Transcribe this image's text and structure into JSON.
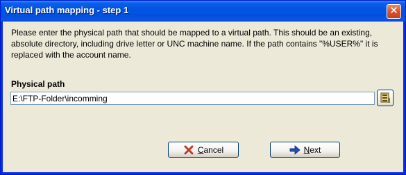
{
  "window": {
    "title": "Virtual path mapping - step 1",
    "close_glyph": "✕"
  },
  "content": {
    "description": "Please enter the physical path that should be mapped to a virtual path. This should be an existing, absolute directory, including drive letter or UNC machine name. If the path contains \"%USER%\" it is replaced with the account name.",
    "physical_path_label": "Physical path",
    "physical_path_value": "E:\\FTP-Folder\\incomming"
  },
  "buttons": {
    "cancel_prefix": "",
    "cancel_mnemonic": "C",
    "cancel_rest": "ancel",
    "next_prefix": "",
    "next_mnemonic": "N",
    "next_rest": "ext"
  },
  "icons": {
    "close": "close-icon",
    "browse": "folder-browse-icon",
    "cancel": "red-x-icon",
    "next": "blue-arrow-right-icon"
  },
  "colors": {
    "titlebar": "#0053e1",
    "dialog_bg": "#ece9d8",
    "cancel_icon": "#c0392b",
    "next_icon": "#1f4fb5"
  }
}
